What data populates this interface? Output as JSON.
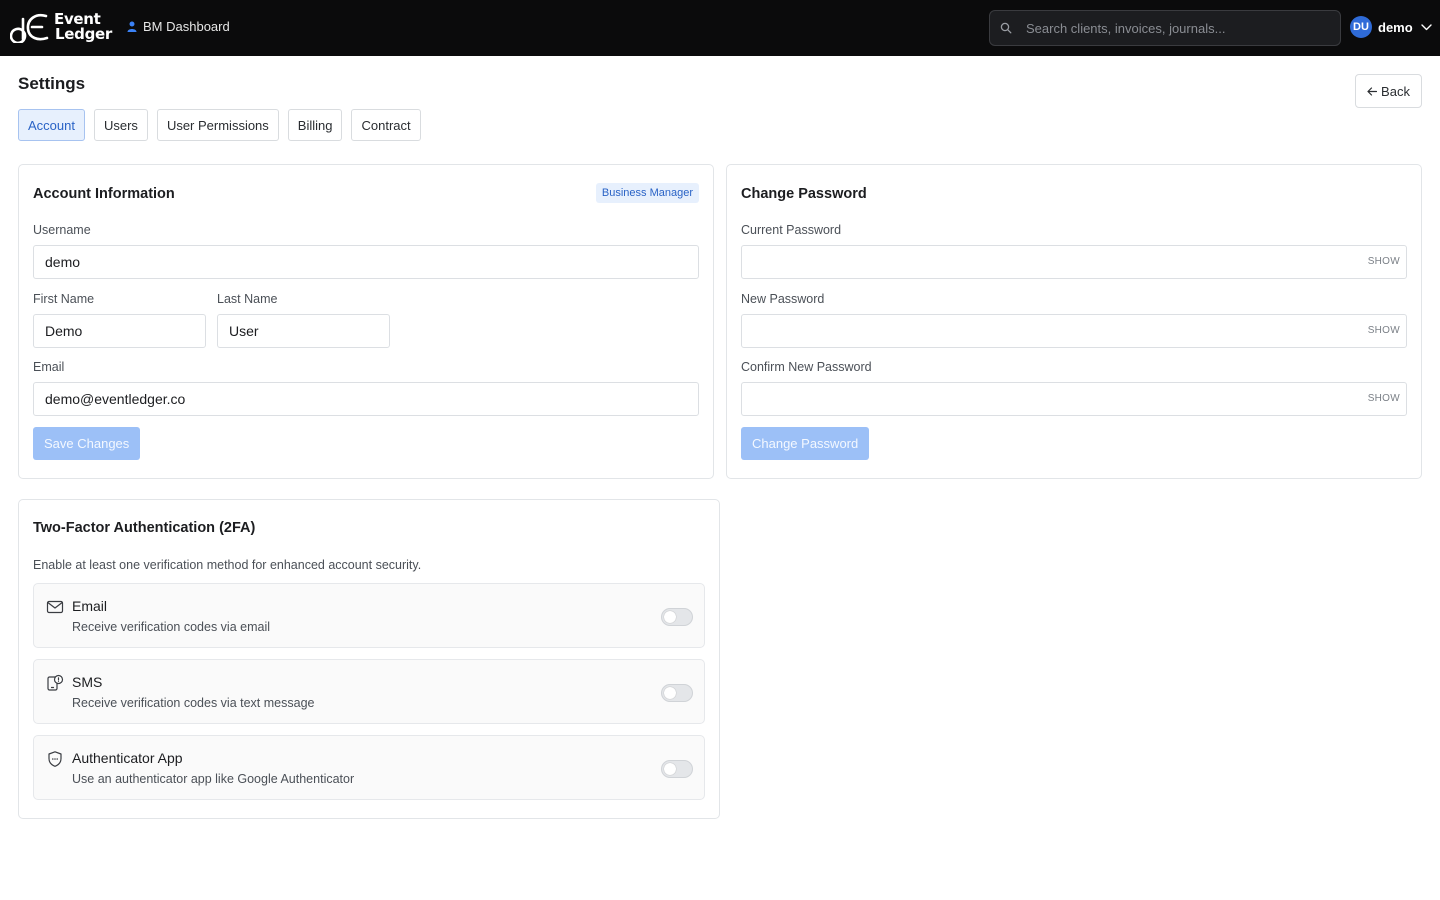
{
  "header": {
    "logo_line1": "Event",
    "logo_line2": "Ledger",
    "dashboard_link": "BM Dashboard",
    "search_placeholder": "Search clients, invoices, journals...",
    "user_initials": "DU",
    "user_name": "demo"
  },
  "page": {
    "title": "Settings",
    "back_label": "Back",
    "tabs": [
      {
        "label": "Account",
        "active": true
      },
      {
        "label": "Users",
        "active": false
      },
      {
        "label": "User Permissions",
        "active": false
      },
      {
        "label": "Billing",
        "active": false
      },
      {
        "label": "Contract",
        "active": false
      }
    ]
  },
  "account_info": {
    "title": "Account Information",
    "role_badge": "Business Manager",
    "username_label": "Username",
    "username_value": "demo",
    "first_name_label": "First Name",
    "first_name_value": "Demo",
    "last_name_label": "Last Name",
    "last_name_value": "User",
    "email_label": "Email",
    "email_value": "demo@eventledger.co",
    "save_label": "Save Changes"
  },
  "change_password": {
    "title": "Change Password",
    "current_label": "Current Password",
    "new_label": "New Password",
    "confirm_label": "Confirm New Password",
    "show_label": "SHOW",
    "submit_label": "Change Password"
  },
  "two_factor": {
    "title": "Two-Factor Authentication (2FA)",
    "description": "Enable at least one verification method for enhanced account security.",
    "methods": [
      {
        "title": "Email",
        "subtitle": "Receive verification codes via email",
        "icon": "mail-icon",
        "enabled": false
      },
      {
        "title": "SMS",
        "subtitle": "Receive verification codes via text message",
        "icon": "phone-message-icon",
        "enabled": false
      },
      {
        "title": "Authenticator App",
        "subtitle": "Use an authenticator app like Google Authenticator",
        "icon": "shield-icon",
        "enabled": false
      }
    ]
  },
  "colors": {
    "topbar": "#0b0b0c",
    "accent": "#2a63c6",
    "primary_button_disabled": "#9cc0f7",
    "active_tab_bg": "#e7f0fd"
  }
}
